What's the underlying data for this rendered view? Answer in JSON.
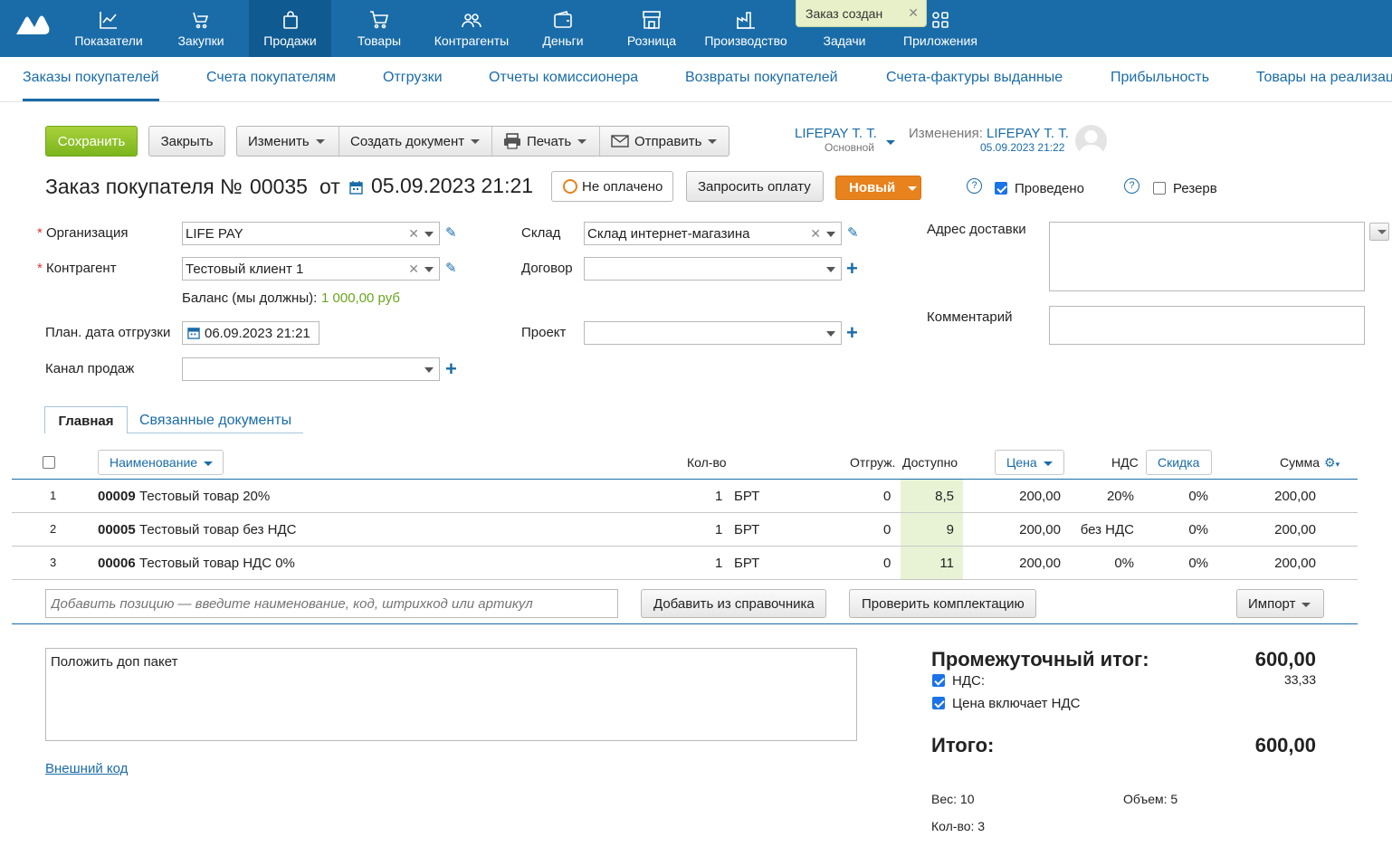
{
  "topnav": {
    "items": [
      {
        "label": "Показатели",
        "icon": "chart-icon"
      },
      {
        "label": "Закупки",
        "icon": "cart-hand-icon"
      },
      {
        "label": "Продажи",
        "icon": "bag-icon"
      },
      {
        "label": "Товары",
        "icon": "cart-icon"
      },
      {
        "label": "Контрагенты",
        "icon": "people-icon"
      },
      {
        "label": "Деньги",
        "icon": "wallet-icon"
      },
      {
        "label": "Розница",
        "icon": "store-icon"
      },
      {
        "label": "Производство",
        "icon": "factory-icon"
      },
      {
        "label": "Задачи",
        "icon": "tasks-icon"
      },
      {
        "label": "Приложения",
        "icon": "apps-icon"
      }
    ],
    "toast": "Заказ создан"
  },
  "subnav": {
    "tabs": [
      "Заказы покупателей",
      "Счета покупателям",
      "Отгрузки",
      "Отчеты комиссионера",
      "Возвраты покупателей",
      "Счета-фактуры выданные",
      "Прибыльность",
      "Товары на реализац"
    ]
  },
  "toolbar": {
    "save": "Сохранить",
    "close": "Закрыть",
    "edit": "Изменить",
    "create_doc": "Создать документ",
    "print": "Печать",
    "send": "Отправить",
    "owner_name": "LIFEPAY Т. Т.",
    "owner_group": "Основной",
    "changes_label": "Изменения:",
    "changes_user": "LIFEPAY Т. Т.",
    "changes_time": "05.09.2023 21:22"
  },
  "doc": {
    "title": "Заказ покупателя №",
    "number": "00035",
    "from": "от",
    "datetime": "05.09.2023 21:21",
    "payment_status": "Не оплачено",
    "request_payment": "Запросить оплату",
    "status": "Новый",
    "posted_label": "Проведено",
    "posted": true,
    "reserve_label": "Резерв",
    "reserve": false
  },
  "form": {
    "org_label": "Организация",
    "org_value": "LIFE PAY",
    "counterparty_label": "Контрагент",
    "counterparty_value": "Тестовый клиент 1",
    "balance_label": "Баланс (мы должны):",
    "balance_value": "1 000,00 руб",
    "ship_date_label": "План. дата отгрузки",
    "ship_date_value": "06.09.2023 21:21",
    "channel_label": "Канал продаж",
    "channel_value": "",
    "warehouse_label": "Склад",
    "warehouse_value": "Склад интернет-магазина",
    "contract_label": "Договор",
    "contract_value": "",
    "project_label": "Проект",
    "project_value": "",
    "address_label": "Адрес доставки",
    "comment_label": "Комментарий"
  },
  "tabs": {
    "main": "Главная",
    "related": "Связанные документы"
  },
  "table": {
    "headers": {
      "name": "Наименование",
      "qty": "Кол-во",
      "shipped": "Отгруж.",
      "available": "Доступно",
      "price": "Цена",
      "vat": "НДС",
      "discount": "Скидка",
      "sum": "Сумма"
    },
    "rows": [
      {
        "n": "1",
        "code": "00009",
        "name": "Тестовый товар 20%",
        "qty": "1",
        "unit": "БРТ",
        "shipped": "0",
        "available": "8,5",
        "price": "200,00",
        "vat": "20%",
        "discount": "0%",
        "sum": "200,00"
      },
      {
        "n": "2",
        "code": "00005",
        "name": "Тестовый товар без НДС",
        "qty": "1",
        "unit": "БРТ",
        "shipped": "0",
        "available": "9",
        "price": "200,00",
        "vat": "без НДС",
        "discount": "0%",
        "sum": "200,00"
      },
      {
        "n": "3",
        "code": "00006",
        "name": "Тестовый товар НДС 0%",
        "qty": "1",
        "unit": "БРТ",
        "shipped": "0",
        "available": "11",
        "price": "200,00",
        "vat": "0%",
        "discount": "0%",
        "sum": "200,00"
      }
    ],
    "add_placeholder": "Добавить позицию — введите наименование, код, штрихкод или артикул",
    "add_from_catalog": "Добавить из справочника",
    "check_kit": "Проверить комплектацию",
    "import": "Импорт"
  },
  "notes": {
    "text": "Положить доп пакет",
    "external_code": "Внешний код"
  },
  "totals": {
    "subtotal_label": "Промежуточный итог:",
    "subtotal": "600,00",
    "vat_label": "НДС:",
    "vat": "33,33",
    "price_incl_vat": "Цена включает НДС",
    "total_label": "Итого:",
    "total": "600,00",
    "weight": "Вес: 10",
    "volume": "Объем: 5",
    "qty": "Кол-во: 3"
  },
  "colors": {
    "brand": "#1a6ca8",
    "save": "#8cc12a",
    "status": "#e8821c",
    "available_bg": "#e8f3d6"
  }
}
